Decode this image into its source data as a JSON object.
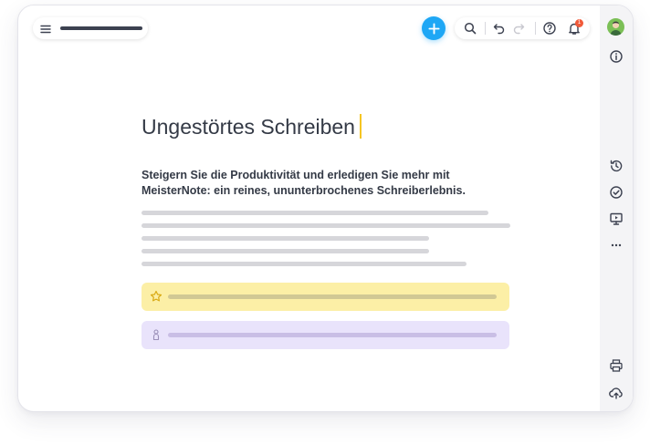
{
  "document": {
    "title": "Ungestörtes Schreiben",
    "subtitle": "Steigern Sie die Produktivität und erledigen Sie mehr mit MeisterNote: ein reines, ununterbrochenes Schreiberlebnis."
  },
  "notifications": {
    "count": "1"
  },
  "colors": {
    "accent": "#1ea7f5",
    "caret": "#f5c523",
    "callout_yellow": "#fcefa6",
    "callout_purple": "#e9e3fb",
    "text": "#343a46",
    "placeholder_line": "#d6d6da"
  },
  "icons": {
    "topbar": [
      "menu-icon",
      "add-icon",
      "search-icon",
      "undo-icon",
      "redo-icon",
      "help-icon",
      "bell-icon"
    ],
    "sidebar": [
      "avatar",
      "info-icon",
      "history-icon",
      "check-circle-icon",
      "presentation-icon",
      "more-icon",
      "print-icon",
      "cloud-upload-icon"
    ],
    "callouts": [
      "star-icon",
      "person-icon"
    ]
  }
}
